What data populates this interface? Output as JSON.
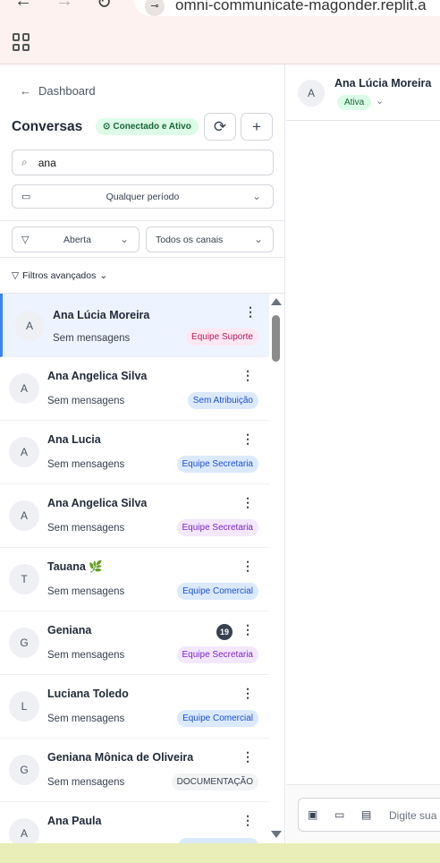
{
  "browser": {
    "url": "omni-communicate-magonder.replit.a"
  },
  "sidebar": {
    "back_label": "Dashboard",
    "title": "Conversas",
    "connection_status": "Conectado e Ativo",
    "search_value": "ana",
    "period_label": "Qualquer período",
    "status_filter": "Aberta",
    "channel_filter": "Todos os canais",
    "advanced_filters": "Filtros avançados"
  },
  "conversations": [
    {
      "initial": "A",
      "name": "Ana Lúcia Moreira",
      "message": "Sem mensagens",
      "tag": "Equipe Suporte",
      "tag_color": "#fce7f3",
      "tag_text": "#be185d"
    },
    {
      "initial": "A",
      "name": "Ana Angelica Silva",
      "message": "Sem mensagens",
      "tag": "Sem Atribuição",
      "tag_color": "#dbeafe",
      "tag_text": "#1d4ed8"
    },
    {
      "initial": "A",
      "name": "Ana Lucia",
      "message": "Sem mensagens",
      "tag": "Equipe Secretaria",
      "tag_color": "#dbeafe",
      "tag_text": "#1d4ed8"
    },
    {
      "initial": "A",
      "name": "Ana Angelica Silva",
      "message": "Sem mensagens",
      "tag": "Equipe Secretaria",
      "tag_color": "#f3e8ff",
      "tag_text": "#7e22ce"
    },
    {
      "initial": "T",
      "name": "Tauana 🌿",
      "message": "Sem mensagens",
      "tag": "Equipe Comercial",
      "tag_color": "#dbeafe",
      "tag_text": "#1d4ed8"
    },
    {
      "initial": "G",
      "name": "Geniana",
      "message": "Sem mensagens",
      "tag": "Equipe Secretaria",
      "tag_color": "#f3e8ff",
      "tag_text": "#7e22ce",
      "unread": "19"
    },
    {
      "initial": "L",
      "name": "Luciana Toledo",
      "message": "Sem mensagens",
      "tag": "Equipe Comercial",
      "tag_color": "#dbeafe",
      "tag_text": "#1d4ed8"
    },
    {
      "initial": "G",
      "name": "Geniana Mônica de Oliveira",
      "message": "Sem mensagens",
      "tag": "DOCUMENTAÇÃO",
      "tag_color": "#f3f4f6",
      "tag_text": "#374151"
    },
    {
      "initial": "A",
      "name": "Ana Paula",
      "message": "",
      "tag": "",
      "tag_color": "#dbeafe",
      "tag_text": "#1d4ed8"
    }
  ],
  "chat": {
    "contact_initial": "A",
    "contact_name": "Ana Lúcia Moreira",
    "status": "Ativa",
    "composer_placeholder": "Digite sua m"
  },
  "icons": [
    "arrow-left-icon",
    "refresh-icon",
    "plus-icon",
    "search-icon",
    "calendar-icon",
    "filter-icon",
    "chevron-down-icon",
    "more-vertical-icon",
    "image-icon",
    "video-icon",
    "document-icon",
    "apps-grid-icon",
    "site-info-icon"
  ]
}
